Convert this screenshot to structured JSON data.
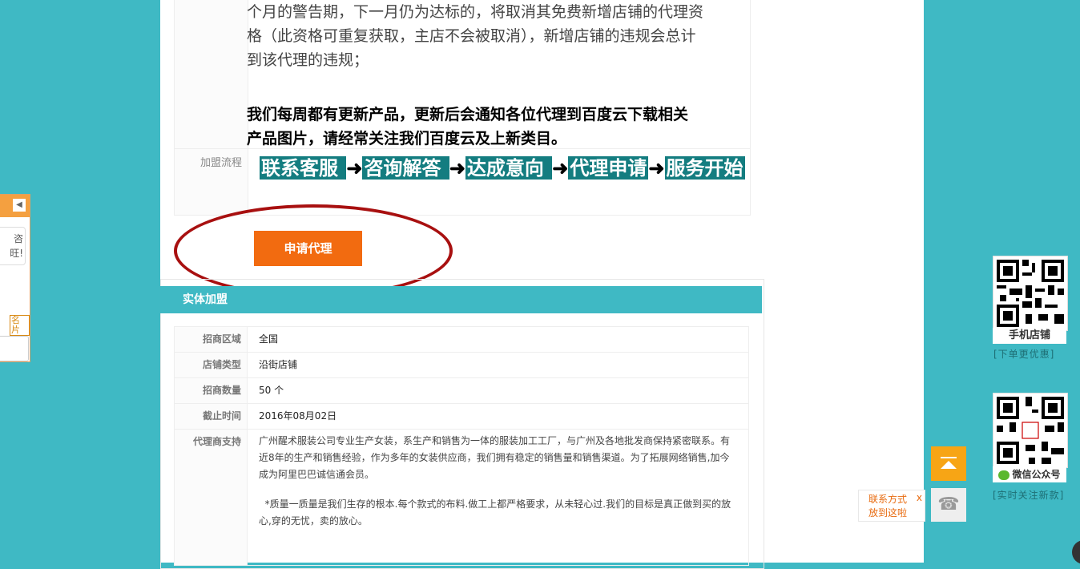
{
  "intro": {
    "lines": [
      "个月的警告期，下一月仍为达标的，将取消其免费新增店铺的代理资",
      "格（此资格可重复获取，主店不会被取消），新增店铺的违规会总计",
      "到该代理的违规；"
    ],
    "bold_lines": [
      "我们每周都有更新产品，更新后会通知各位代理到百度云下载相关",
      "产品图片，请经常关注我们百度云及上新类目。"
    ]
  },
  "flow": {
    "label": "加盟流程",
    "steps": [
      " 联系客服 ",
      "咨询解答 ",
      "达成意向 ",
      "代理申请",
      "服务开始"
    ],
    "arrow": "➜"
  },
  "apply_button": "申请代理",
  "section": {
    "title": "实体加盟",
    "rows": [
      {
        "label": "招商区域",
        "value": "全国"
      },
      {
        "label": "店铺类型",
        "value": "沿街店铺"
      },
      {
        "label": "招商数量",
        "value": "50 个"
      },
      {
        "label": "截止时间",
        "value": "2016年08月02日"
      }
    ],
    "support": {
      "label": "代理商支持",
      "paragraphs": [
        "广州醒术服装公司专业生产女装，系生产和销售为一体的服装加工工厂，与广州及各地批发商保持紧密联系。有近8年的生产和销售经验，作为多年的女装供应商，我们拥有稳定的销售量和销售渠道。为了拓展网络销售,加今成为阿里巴巴诚信通会员。",
        "  *质量一质量是我们生存的根本.每个款式的布料.做工上都严格要求，从未轻心过.我们的目标是真正做到买的放心,穿的无忧，卖的放心。"
      ]
    }
  },
  "side": {
    "qr1_label": "手机店铺",
    "qr1_note": "[下单更优惠]",
    "qr2_label": "微信公众号",
    "qr2_note": "[实时关注新款]",
    "contact_tip_line1": "联系方式",
    "contact_tip_line2": "放到这啦",
    "contact_close": "x",
    "phone_icon": "☎"
  },
  "left_widget": {
    "bubble_line1": "咨",
    "bubble_line2": "旺!",
    "tag": "名片"
  }
}
